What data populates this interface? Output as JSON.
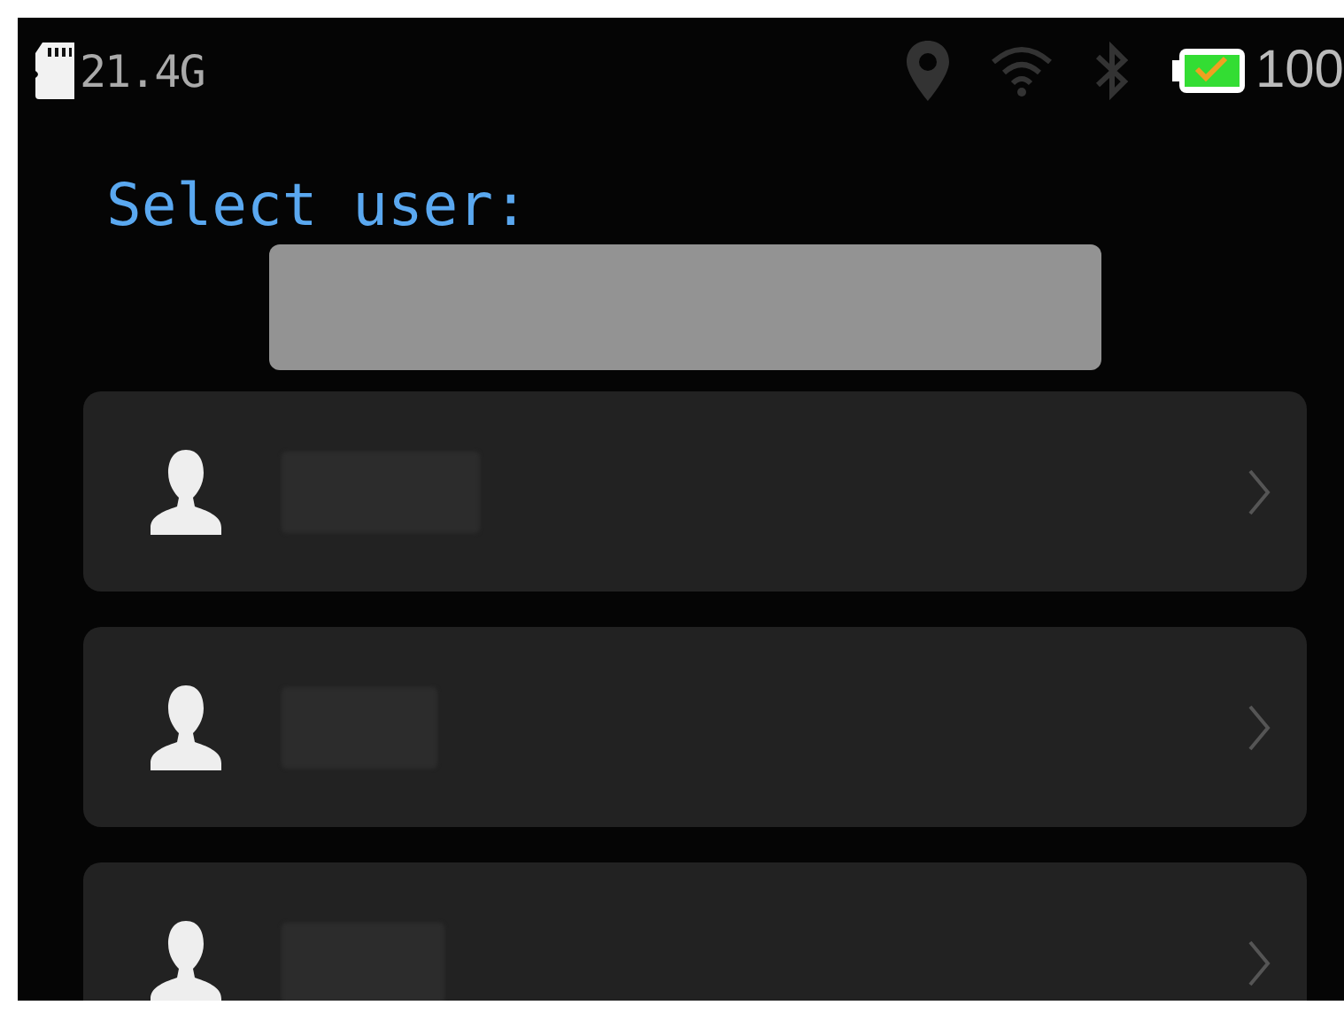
{
  "status_bar": {
    "storage": "21.4G",
    "location": {
      "on": false
    },
    "wifi": {
      "on": false
    },
    "bluetooth": {
      "on": false
    },
    "battery": {
      "charged": true
    },
    "battery_text": "100"
  },
  "title": "Select user:",
  "selected_user_field": {
    "kind": "blank"
  },
  "users": [
    {
      "kind": "user"
    },
    {
      "kind": "user"
    },
    {
      "kind": "user"
    }
  ]
}
